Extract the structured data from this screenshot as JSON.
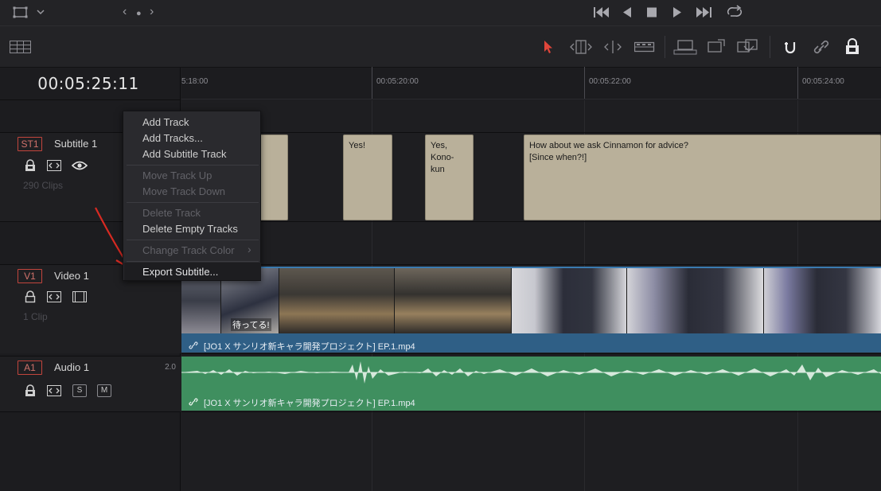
{
  "topbar": {
    "layout_icon": "viewer-layout-icon",
    "dropdown_icon": "chevron-down-icon",
    "nav_prev": "‹",
    "nav_dot": "●",
    "nav_next": "›"
  },
  "transport": {
    "buttons": [
      "go-to-start",
      "previous-frame",
      "stop",
      "play",
      "go-to-end",
      "loop"
    ]
  },
  "toolbar": {
    "tools": [
      "timeline-view-options",
      "selection-mode",
      "trim-edit-mode",
      "dynamic-trim-mode",
      "blade-edit-mode",
      "insert-clip",
      "overwrite-clip",
      "replace-clip",
      "snapping",
      "linked-selection",
      "position-lock"
    ]
  },
  "timeline": {
    "timecode": "00:05:25:11",
    "ruler_labels": [
      "5:18:00",
      "00:05:20:00",
      "00:05:22:00",
      "00:05:24:00"
    ]
  },
  "tracks": {
    "subtitle": {
      "id": "ST1",
      "name": "Subtitle 1",
      "clips": "290 Clips"
    },
    "video": {
      "id": "V1",
      "name": "Video 1",
      "clips": "1 Clip"
    },
    "audio": {
      "id": "A1",
      "name": "Audio 1",
      "channels": "2.0",
      "solo": "S",
      "mute": "M"
    }
  },
  "subtitle_clips": [
    {
      "text": ""
    },
    {
      "text": "Yes!"
    },
    {
      "text": "Yes,\nKono-\nkun"
    },
    {
      "text": "How about we ask Cinnamon for advice?\n[Since when?!]"
    }
  ],
  "video_clip": {
    "name": "[JO1 X サンリオ新キャラ開発プロジェクト] EP.1.mp4",
    "caption_overlay": "待ってる!"
  },
  "audio_clip": {
    "name": "[JO1 X サンリオ新キャラ開発プロジェクト] EP.1.mp4"
  },
  "context_menu": {
    "items": [
      {
        "label": "Add Track",
        "enabled": true
      },
      {
        "label": "Add Tracks...",
        "enabled": true
      },
      {
        "label": "Add Subtitle Track",
        "enabled": true
      },
      {
        "label": "Move Track Up",
        "enabled": false
      },
      {
        "label": "Move Track Down",
        "enabled": false
      },
      {
        "label": "Delete Track",
        "enabled": false
      },
      {
        "label": "Delete Empty Tracks",
        "enabled": true
      },
      {
        "label": "Change Track Color",
        "enabled": false,
        "submenu_arrow": "›"
      },
      {
        "label": "Export Subtitle...",
        "enabled": true,
        "highlighted": true
      }
    ]
  },
  "colors": {
    "accent_red": "#c2453d",
    "selection_cursor": "#e0453a",
    "subtitle_clip": "#b9b09a",
    "video_clip": "#2f5f86",
    "audio_clip": "#3f8f5f"
  }
}
